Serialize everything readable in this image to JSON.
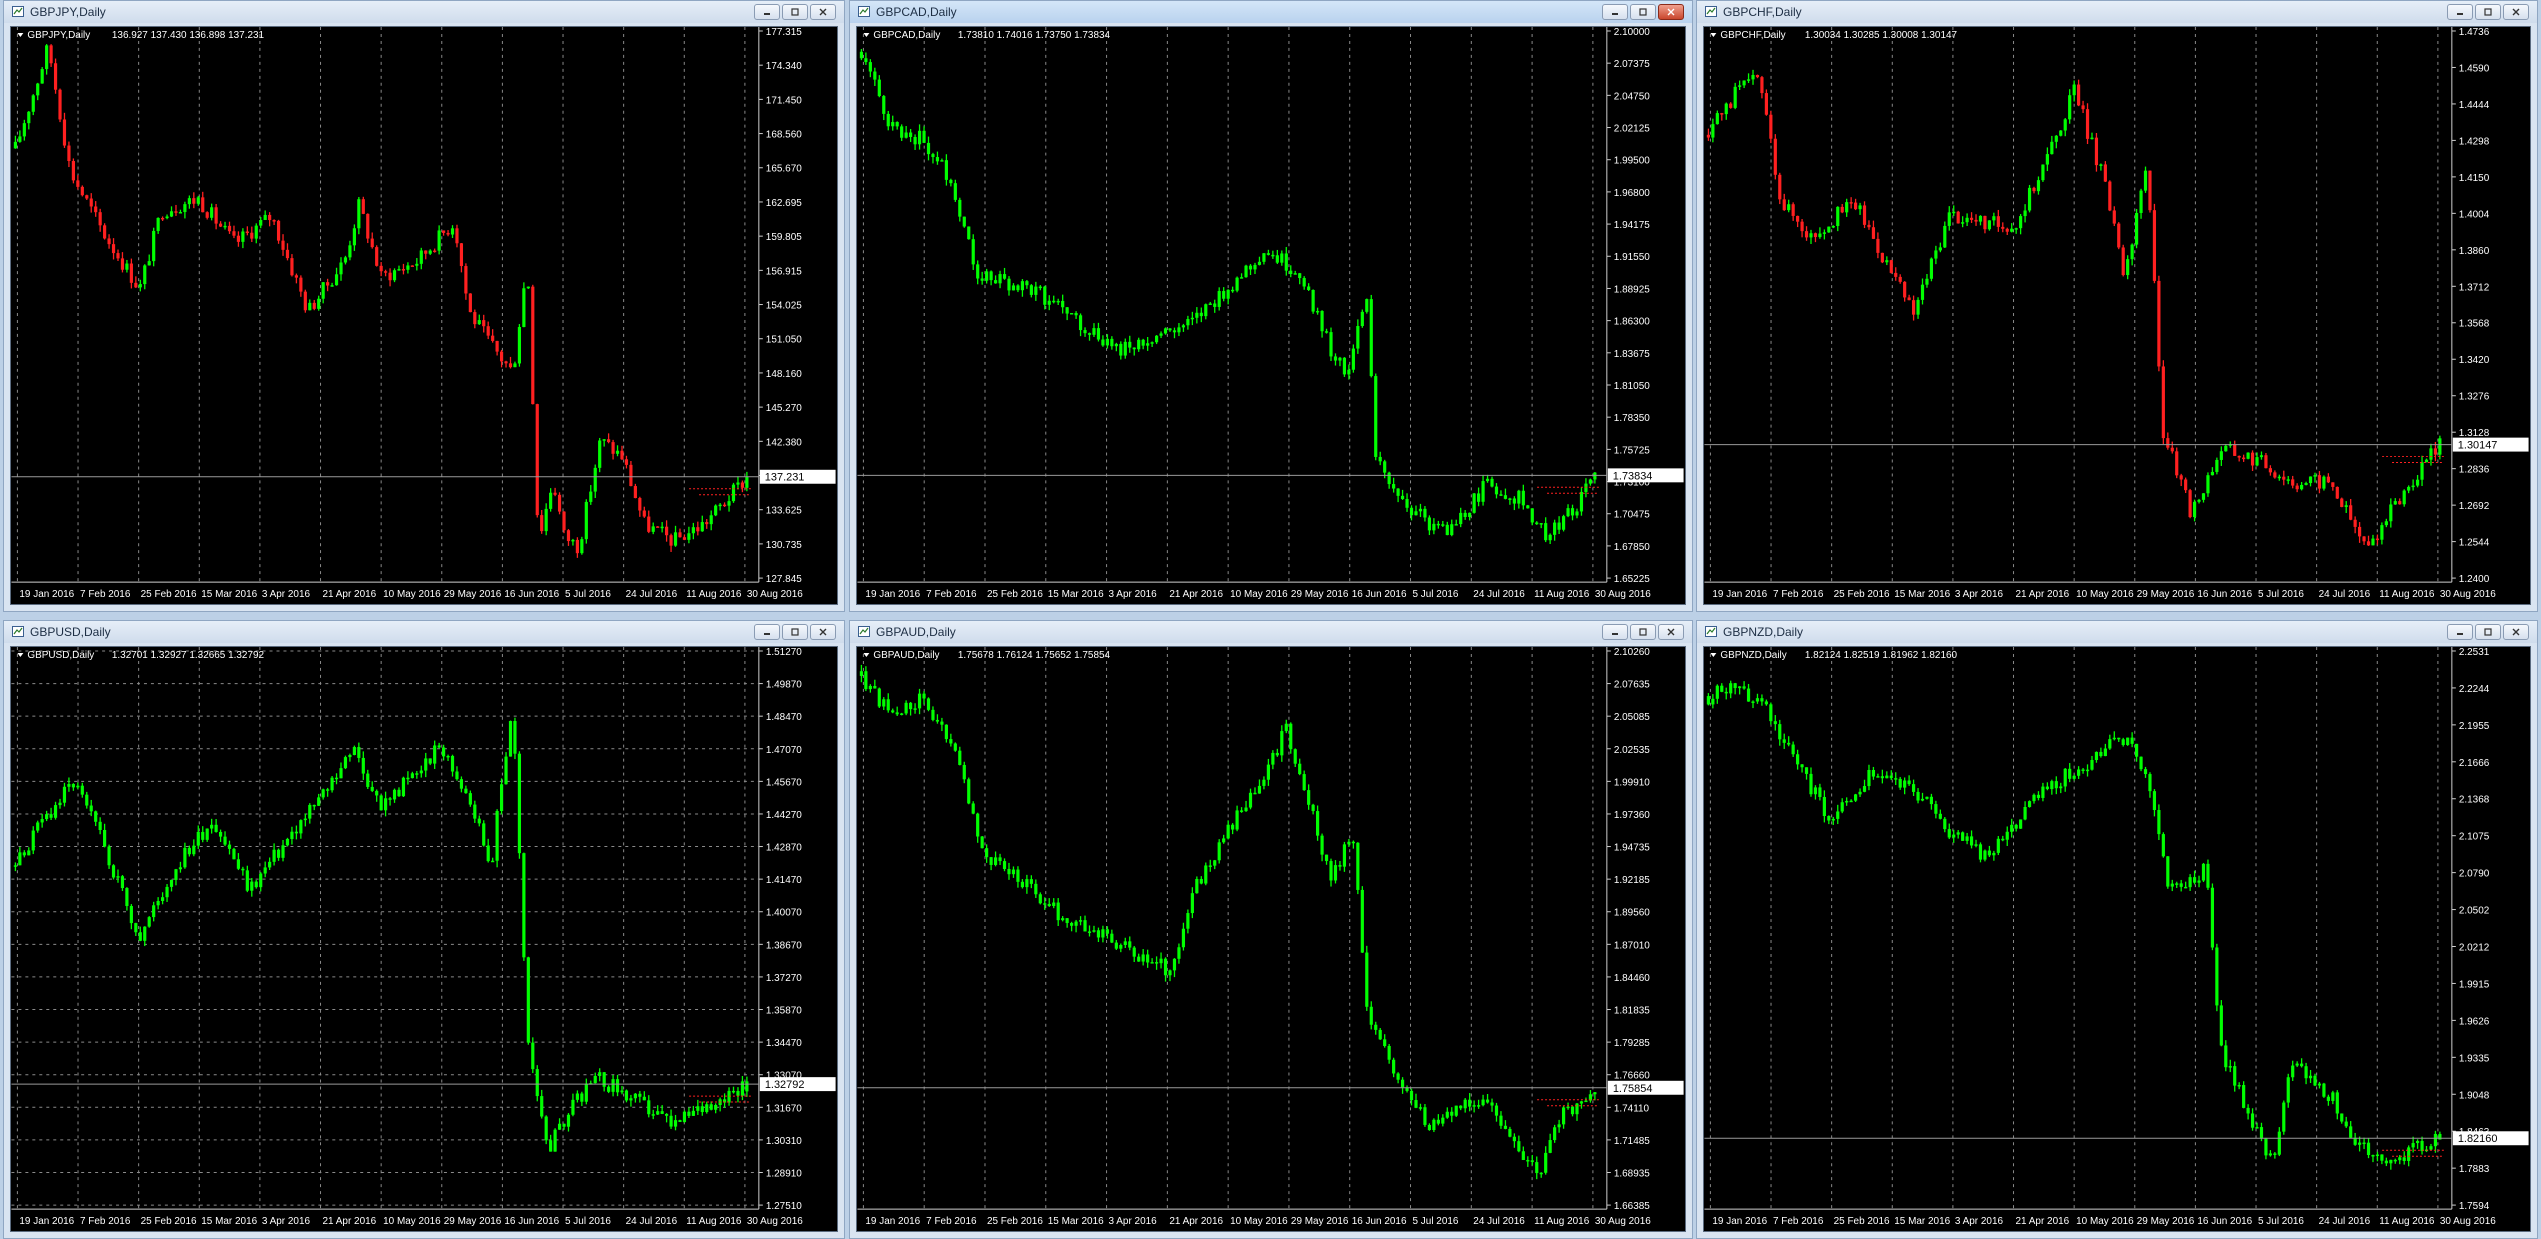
{
  "windows": [
    {
      "title": "GBPJPY,Daily",
      "symbol_label": "GBPJPY,Daily",
      "ohlc": "136.927 137.430 136.898 137.231",
      "price_tag": "137.231",
      "active": false,
      "grid": false,
      "y_ticks": [
        "177.315",
        "174.340",
        "171.450",
        "168.560",
        "165.670",
        "162.695",
        "159.805",
        "156.915",
        "154.025",
        "151.050",
        "148.160",
        "145.270",
        "142.380",
        "139.490",
        "133.625",
        "130.735",
        "127.845"
      ],
      "x_ticks": [
        "19 Jan 2016",
        "7 Feb 2016",
        "25 Feb 2016",
        "15 Mar 2016",
        "3 Apr 2016",
        "21 Apr 2016",
        "10 May 2016",
        "29 May 2016",
        "16 Jun 2016",
        "5 Jul 2016",
        "24 Jul 2016",
        "11 Aug 2016",
        "30 Aug 2016"
      ],
      "chart_data": {
        "type": "candlestick",
        "title": "GBPJPY,Daily",
        "ylim": [
          127.845,
          177.315
        ],
        "last_close": 137.231,
        "path": [
          [
            0,
            166.5
          ],
          [
            0.03,
            172.5
          ],
          [
            0.045,
            175.6
          ],
          [
            0.075,
            164.5
          ],
          [
            0.12,
            159
          ],
          [
            0.17,
            154
          ],
          [
            0.2,
            161
          ],
          [
            0.25,
            162
          ],
          [
            0.3,
            158
          ],
          [
            0.35,
            160.5
          ],
          [
            0.4,
            152
          ],
          [
            0.45,
            156.5
          ],
          [
            0.47,
            161.5
          ],
          [
            0.5,
            155
          ],
          [
            0.55,
            156.5
          ],
          [
            0.6,
            160
          ],
          [
            0.62,
            152
          ],
          [
            0.65,
            149
          ],
          [
            0.68,
            146.5
          ],
          [
            0.7,
            156.5
          ],
          [
            0.715,
            131.5
          ],
          [
            0.735,
            137
          ],
          [
            0.75,
            132
          ],
          [
            0.77,
            131
          ],
          [
            0.8,
            140.5
          ],
          [
            0.83,
            139
          ],
          [
            0.86,
            133
          ],
          [
            0.9,
            131.5
          ],
          [
            0.94,
            133
          ],
          [
            0.97,
            135
          ],
          [
            1,
            137.2
          ]
        ]
      }
    },
    {
      "title": "GBPCAD,Daily",
      "symbol_label": "GBPCAD,Daily",
      "ohlc": "1.73810 1.74016 1.73750 1.73834",
      "price_tag": "1.73834",
      "active": true,
      "grid": false,
      "y_ticks": [
        "2.10000",
        "2.07375",
        "2.04750",
        "2.02125",
        "1.99500",
        "1.96800",
        "1.94175",
        "1.91550",
        "1.88925",
        "1.86300",
        "1.83675",
        "1.81050",
        "1.78350",
        "1.75725",
        "1.73100",
        "1.70475",
        "1.67850",
        "1.65225"
      ],
      "x_ticks": [
        "19 Jan 2016",
        "7 Feb 2016",
        "25 Feb 2016",
        "15 Mar 2016",
        "3 Apr 2016",
        "21 Apr 2016",
        "10 May 2016",
        "29 May 2016",
        "16 Jun 2016",
        "5 Jul 2016",
        "24 Jul 2016",
        "11 Aug 2016",
        "30 Aug 2016"
      ],
      "chart_data": {
        "type": "candlestick",
        "title": "GBPCAD,Daily",
        "ylim": [
          1.65225,
          2.1
        ],
        "last_close": 1.73834,
        "path": [
          [
            0,
            2.08
          ],
          [
            0.04,
            2.02
          ],
          [
            0.08,
            2.01
          ],
          [
            0.12,
            1.98
          ],
          [
            0.16,
            1.9
          ],
          [
            0.22,
            1.89
          ],
          [
            0.26,
            1.88
          ],
          [
            0.3,
            1.86
          ],
          [
            0.35,
            1.84
          ],
          [
            0.4,
            1.85
          ],
          [
            0.45,
            1.86
          ],
          [
            0.5,
            1.89
          ],
          [
            0.55,
            1.92
          ],
          [
            0.6,
            1.9
          ],
          [
            0.64,
            1.84
          ],
          [
            0.66,
            1.82
          ],
          [
            0.69,
            1.88
          ],
          [
            0.7,
            1.75
          ],
          [
            0.75,
            1.71
          ],
          [
            0.8,
            1.69
          ],
          [
            0.85,
            1.73
          ],
          [
            0.9,
            1.72
          ],
          [
            0.93,
            1.69
          ],
          [
            0.97,
            1.71
          ],
          [
            1,
            1.738
          ]
        ]
      }
    },
    {
      "title": "GBPCHF,Daily",
      "symbol_label": "GBPCHF,Daily",
      "ohlc": "1.30034 1.30285 1.30008 1.30147",
      "price_tag": "1.30147",
      "active": false,
      "grid": false,
      "y_ticks": [
        "1.4736",
        "1.4590",
        "1.4444",
        "1.4298",
        "1.4150",
        "1.4004",
        "1.3860",
        "1.3712",
        "1.3568",
        "1.3420",
        "1.3276",
        "1.3128",
        "1.2836",
        "1.2692",
        "1.2544",
        "1.2400"
      ],
      "x_ticks": [
        "19 Jan 2016",
        "7 Feb 2016",
        "25 Feb 2016",
        "15 Mar 2016",
        "3 Apr 2016",
        "21 Apr 2016",
        "10 May 2016",
        "29 May 2016",
        "16 Jun 2016",
        "5 Jul 2016",
        "24 Jul 2016",
        "11 Aug 2016",
        "30 Aug 2016"
      ],
      "chart_data": {
        "type": "candlestick",
        "title": "GBPCHF,Daily",
        "ylim": [
          1.24,
          1.4882
        ],
        "last_close": 1.30147,
        "path": [
          [
            0,
            1.44
          ],
          [
            0.04,
            1.46
          ],
          [
            0.07,
            1.465
          ],
          [
            0.1,
            1.41
          ],
          [
            0.14,
            1.395
          ],
          [
            0.2,
            1.41
          ],
          [
            0.24,
            1.385
          ],
          [
            0.28,
            1.36
          ],
          [
            0.33,
            1.405
          ],
          [
            0.38,
            1.4
          ],
          [
            0.42,
            1.4
          ],
          [
            0.47,
            1.435
          ],
          [
            0.5,
            1.46
          ],
          [
            0.54,
            1.42
          ],
          [
            0.57,
            1.375
          ],
          [
            0.6,
            1.43
          ],
          [
            0.62,
            1.31
          ],
          [
            0.66,
            1.27
          ],
          [
            0.7,
            1.3
          ],
          [
            0.75,
            1.295
          ],
          [
            0.8,
            1.285
          ],
          [
            0.85,
            1.285
          ],
          [
            0.9,
            1.255
          ],
          [
            0.95,
            1.28
          ],
          [
            1,
            1.3015
          ]
        ]
      }
    },
    {
      "title": "GBPUSD,Daily",
      "symbol_label": "GBPUSD,Daily",
      "ohlc": "1.32701 1.32927 1.32665 1.32792",
      "price_tag": "1.32792",
      "active": false,
      "grid": true,
      "y_ticks": [
        "1.51270",
        "1.49870",
        "1.48470",
        "1.47070",
        "1.45670",
        "1.44270",
        "1.42870",
        "1.41470",
        "1.40070",
        "1.38670",
        "1.37270",
        "1.35870",
        "1.34470",
        "1.33070",
        "1.31670",
        "1.30310",
        "1.28910",
        "1.27510"
      ],
      "x_ticks": [
        "19 Jan 2016",
        "7 Feb 2016",
        "25 Feb 2016",
        "15 Mar 2016",
        "3 Apr 2016",
        "21 Apr 2016",
        "10 May 2016",
        "29 May 2016",
        "16 Jun 2016",
        "5 Jul 2016",
        "24 Jul 2016",
        "11 Aug 2016",
        "30 Aug 2016"
      ],
      "chart_data": {
        "type": "candlestick",
        "title": "GBPUSD,Daily",
        "ylim": [
          1.2751,
          1.5127
        ],
        "last_close": 1.32792,
        "path": [
          [
            0,
            1.42
          ],
          [
            0.04,
            1.44
          ],
          [
            0.08,
            1.455
          ],
          [
            0.12,
            1.43
          ],
          [
            0.17,
            1.39
          ],
          [
            0.22,
            1.42
          ],
          [
            0.27,
            1.44
          ],
          [
            0.32,
            1.41
          ],
          [
            0.37,
            1.43
          ],
          [
            0.42,
            1.45
          ],
          [
            0.46,
            1.47
          ],
          [
            0.5,
            1.445
          ],
          [
            0.55,
            1.46
          ],
          [
            0.58,
            1.47
          ],
          [
            0.62,
            1.45
          ],
          [
            0.65,
            1.42
          ],
          [
            0.68,
            1.49
          ],
          [
            0.7,
            1.345
          ],
          [
            0.73,
            1.3
          ],
          [
            0.76,
            1.32
          ],
          [
            0.8,
            1.33
          ],
          [
            0.85,
            1.32
          ],
          [
            0.9,
            1.31
          ],
          [
            0.95,
            1.32
          ],
          [
            1,
            1.328
          ]
        ]
      }
    },
    {
      "title": "GBPAUD,Daily",
      "symbol_label": "GBPAUD,Daily",
      "ohlc": "1.75678 1.76124 1.75652 1.75854",
      "price_tag": "1.75854",
      "active": false,
      "grid": false,
      "y_ticks": [
        "2.10260",
        "2.07635",
        "2.05085",
        "2.02535",
        "1.99910",
        "1.97360",
        "1.94735",
        "1.92185",
        "1.89560",
        "1.87010",
        "1.84460",
        "1.81835",
        "1.79285",
        "1.76660",
        "1.74110",
        "1.71485",
        "1.68935",
        "1.66385"
      ],
      "x_ticks": [
        "19 Jan 2016",
        "7 Feb 2016",
        "25 Feb 2016",
        "15 Mar 2016",
        "3 Apr 2016",
        "21 Apr 2016",
        "10 May 2016",
        "29 May 2016",
        "16 Jun 2016",
        "5 Jul 2016",
        "24 Jul 2016",
        "11 Aug 2016",
        "30 Aug 2016"
      ],
      "chart_data": {
        "type": "candlestick",
        "title": "GBPAUD,Daily",
        "ylim": [
          1.66385,
          2.1026
        ],
        "last_close": 1.75854,
        "path": [
          [
            0,
            2.08
          ],
          [
            0.04,
            2.05
          ],
          [
            0.08,
            2.06
          ],
          [
            0.12,
            2.03
          ],
          [
            0.17,
            1.94
          ],
          [
            0.22,
            1.92
          ],
          [
            0.28,
            1.89
          ],
          [
            0.33,
            1.88
          ],
          [
            0.38,
            1.86
          ],
          [
            0.42,
            1.85
          ],
          [
            0.46,
            1.92
          ],
          [
            0.5,
            1.96
          ],
          [
            0.55,
            2.0
          ],
          [
            0.58,
            2.04
          ],
          [
            0.61,
            1.98
          ],
          [
            0.64,
            1.92
          ],
          [
            0.67,
            1.96
          ],
          [
            0.69,
            1.82
          ],
          [
            0.73,
            1.77
          ],
          [
            0.77,
            1.73
          ],
          [
            0.81,
            1.74
          ],
          [
            0.85,
            1.75
          ],
          [
            0.88,
            1.73
          ],
          [
            0.92,
            1.69
          ],
          [
            0.96,
            1.74
          ],
          [
            1,
            1.7585
          ]
        ]
      }
    },
    {
      "title": "GBPNZD,Daily",
      "symbol_label": "GBPNZD,Daily",
      "ohlc": "1.82124 1.82519 1.81962 1.82160",
      "price_tag": "1.82160",
      "active": false,
      "grid": false,
      "y_ticks": [
        "2.2531",
        "2.2244",
        "2.1955",
        "2.1666",
        "2.1368",
        "2.1075",
        "2.0790",
        "2.0502",
        "2.0212",
        "1.9915",
        "1.9626",
        "1.9335",
        "1.9048",
        "1.8463",
        "1.7883",
        "1.7594"
      ],
      "x_ticks": [
        "19 Jan 2016",
        "7 Feb 2016",
        "25 Feb 2016",
        "15 Mar 2016",
        "3 Apr 2016",
        "21 Apr 2016",
        "10 May 2016",
        "29 May 2016",
        "16 Jun 2016",
        "5 Jul 2016",
        "24 Jul 2016",
        "11 Aug 2016",
        "30 Aug 2016"
      ],
      "chart_data": {
        "type": "candlestick",
        "title": "GBPNZD,Daily",
        "ylim": [
          1.7594,
          2.2531
        ],
        "last_close": 1.8216,
        "path": [
          [
            0,
            2.21
          ],
          [
            0.04,
            2.22
          ],
          [
            0.08,
            2.2
          ],
          [
            0.12,
            2.15
          ],
          [
            0.17,
            2.1
          ],
          [
            0.22,
            2.14
          ],
          [
            0.28,
            2.13
          ],
          [
            0.33,
            2.09
          ],
          [
            0.38,
            2.07
          ],
          [
            0.42,
            2.1
          ],
          [
            0.46,
            2.13
          ],
          [
            0.52,
            2.15
          ],
          [
            0.56,
            2.18
          ],
          [
            0.6,
            2.14
          ],
          [
            0.63,
            2.04
          ],
          [
            0.66,
            2.05
          ],
          [
            0.68,
            2.06
          ],
          [
            0.7,
            1.9
          ],
          [
            0.74,
            1.84
          ],
          [
            0.77,
            1.8
          ],
          [
            0.8,
            1.89
          ],
          [
            0.85,
            1.86
          ],
          [
            0.88,
            1.82
          ],
          [
            0.92,
            1.8
          ],
          [
            0.96,
            1.81
          ],
          [
            1,
            1.8216
          ]
        ]
      }
    }
  ],
  "colors": {
    "bull": "#00ff00",
    "bear": "#ff2020",
    "chart_bg": "#000000",
    "grid": "#8a8a8a",
    "price_line": "#9a9a9a"
  }
}
